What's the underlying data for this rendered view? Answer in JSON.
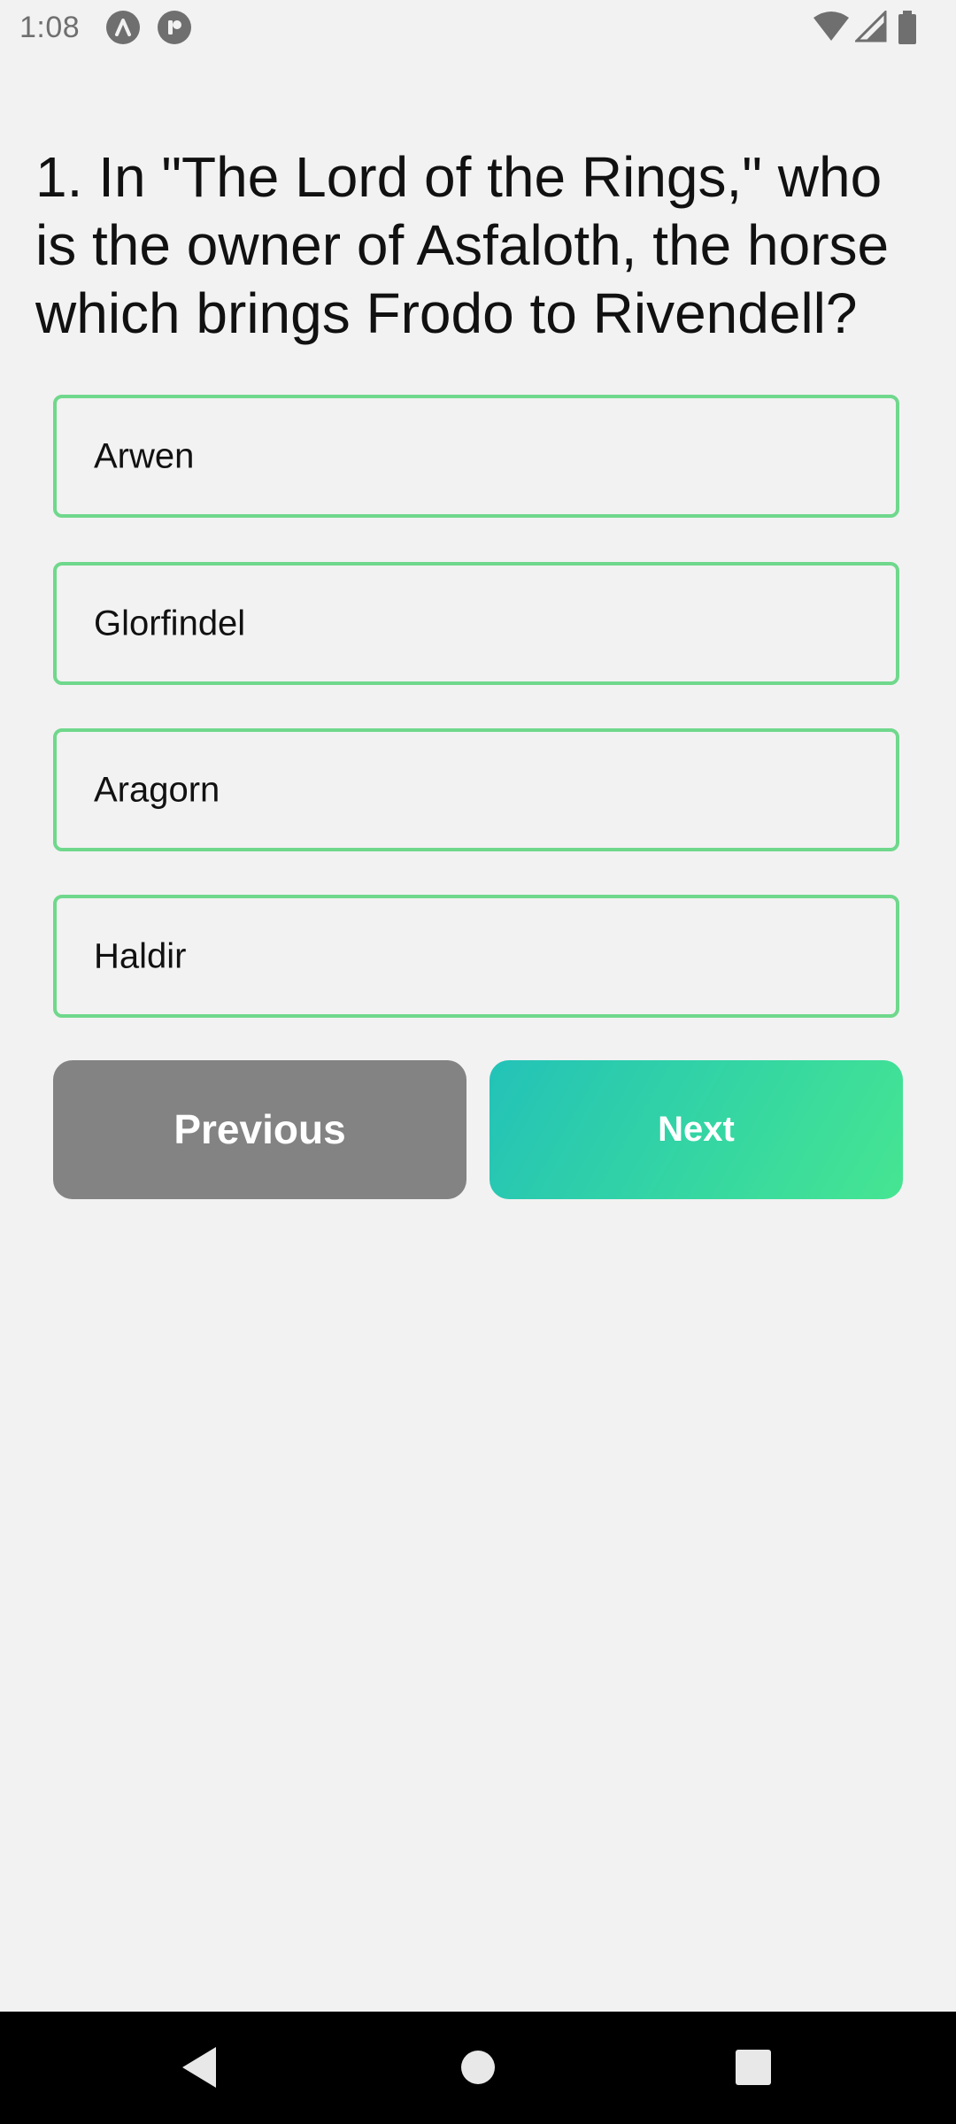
{
  "status_bar": {
    "time": "1:08",
    "notification_icons": [
      "app-a-icon",
      "app-p-icon"
    ],
    "system_icons": [
      "wifi-icon",
      "cell-signal-icon",
      "battery-icon"
    ]
  },
  "quiz": {
    "question": "1. In \"The Lord of the Rings,\" who is the owner of Asfaloth, the horse which brings Frodo to Rivendell?",
    "options": [
      {
        "label": "Arwen"
      },
      {
        "label": "Glorfindel"
      },
      {
        "label": "Aragorn"
      },
      {
        "label": "Haldir"
      }
    ],
    "option_border_color": "#6fd88c"
  },
  "buttons": {
    "previous_label": "Previous",
    "next_label": "Next",
    "previous_color": "#838383",
    "next_gradient": [
      "#23c2b8",
      "#46e592"
    ]
  },
  "nav_bar": {
    "icons": [
      "back-icon",
      "home-icon",
      "recents-icon"
    ]
  }
}
